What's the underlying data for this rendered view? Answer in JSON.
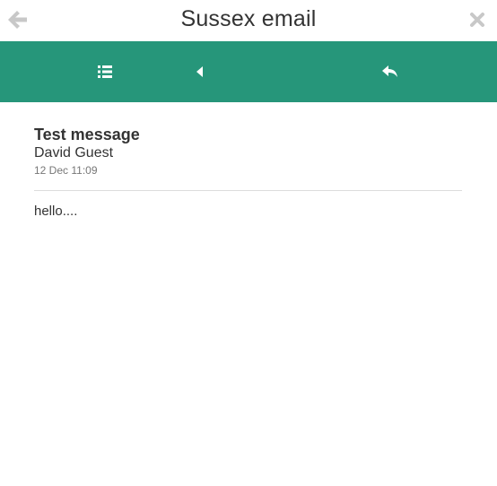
{
  "app": {
    "title": "Sussex email"
  },
  "titlebar": {
    "back_icon": "arrow-left-icon",
    "close_icon": "close-icon"
  },
  "toolbar": {
    "background": "#26967a",
    "buttons": [
      {
        "icon": "list-icon"
      },
      {
        "icon": "triangle-left-icon"
      },
      {
        "icon": "reply-icon"
      }
    ]
  },
  "message": {
    "subject": "Test message",
    "sender": "David Guest",
    "date": "12 Dec 11:09",
    "body": "hello...."
  }
}
